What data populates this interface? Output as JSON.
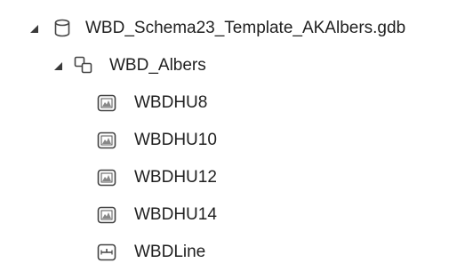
{
  "tree": {
    "root": {
      "label": "WBD_Schema23_Template_AKAlbers.gdb",
      "expanded": true,
      "icon": "database-icon"
    },
    "dataset": {
      "label": "WBD_Albers",
      "expanded": true,
      "icon": "feature-dataset-icon"
    },
    "items": [
      {
        "label": "WBDHU8",
        "icon": "polygon-feature-class-icon"
      },
      {
        "label": "WBDHU10",
        "icon": "polygon-feature-class-icon"
      },
      {
        "label": "WBDHU12",
        "icon": "polygon-feature-class-icon"
      },
      {
        "label": "WBDHU14",
        "icon": "polygon-feature-class-icon"
      },
      {
        "label": "WBDLine",
        "icon": "line-feature-class-icon"
      }
    ]
  },
  "colors": {
    "text": "#1f1f1f",
    "icon_stroke": "#444444",
    "toggle": "#3a3a3a"
  }
}
